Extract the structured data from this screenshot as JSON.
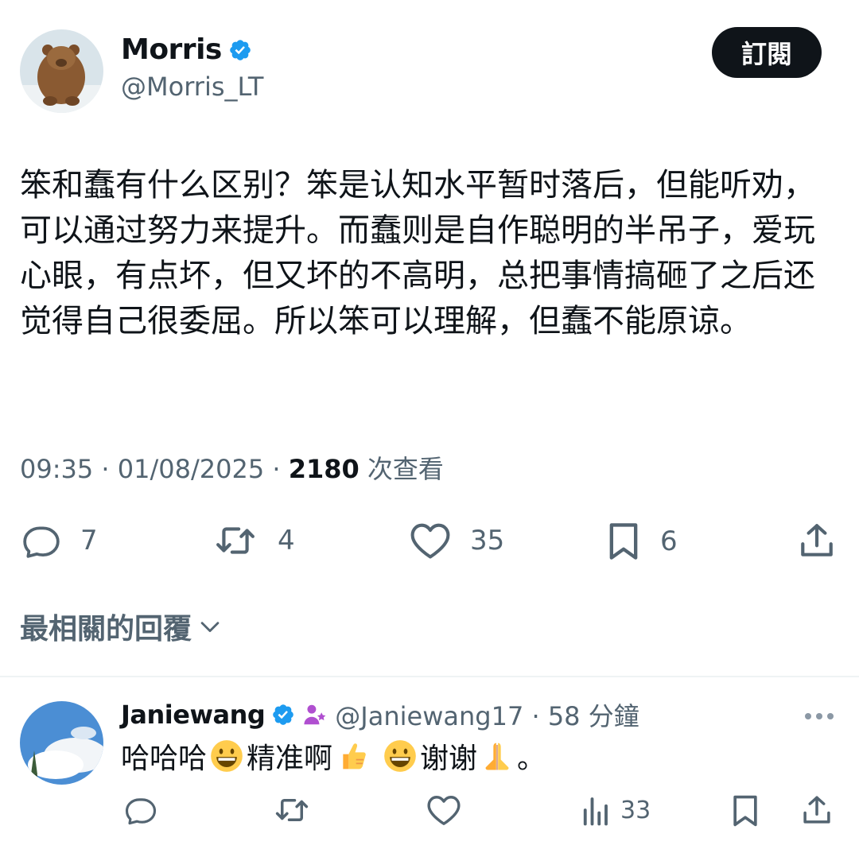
{
  "tweet": {
    "author_name": "Morris",
    "author_handle": "@Morris_LT",
    "subscribe_label": "訂閱",
    "text": "笨和蠢有什么区别？笨是认知水平暂时落后，但能听劝，可以通过努力来提升。而蠢则是自作聪明的半吊子，爱玩心眼，有点坏，但又坏的不高明，总把事情搞砸了之后还觉得自己很委屈。所以笨可以理解，但蠢不能原谅。",
    "timestamp": "09:35 · 01/08/2025 · ",
    "views_count": "2180",
    "views_label": " 次查看",
    "actions": {
      "reply_count": "7",
      "retweet_count": "4",
      "like_count": "35",
      "bookmark_count": "6"
    }
  },
  "replies_header": "最相關的回覆",
  "reply": {
    "author_name": "Janiewang",
    "author_handle": "@Janiewang17 · 58 分鐘",
    "text_part1": "哈哈哈",
    "text_part2": "精准啊",
    "text_part3": "谢谢",
    "text_part4": "。",
    "views_count": "33"
  },
  "icons": {
    "verified": "verified-badge-icon",
    "reply": "comment-icon",
    "retweet": "retweet-icon",
    "like": "heart-icon",
    "bookmark": "bookmark-icon",
    "share": "share-icon",
    "more": "more-icon",
    "views": "analytics-icon"
  },
  "colors": {
    "verified_blue": "#1d9bf0",
    "muted": "#536471",
    "text": "#0f1419"
  }
}
